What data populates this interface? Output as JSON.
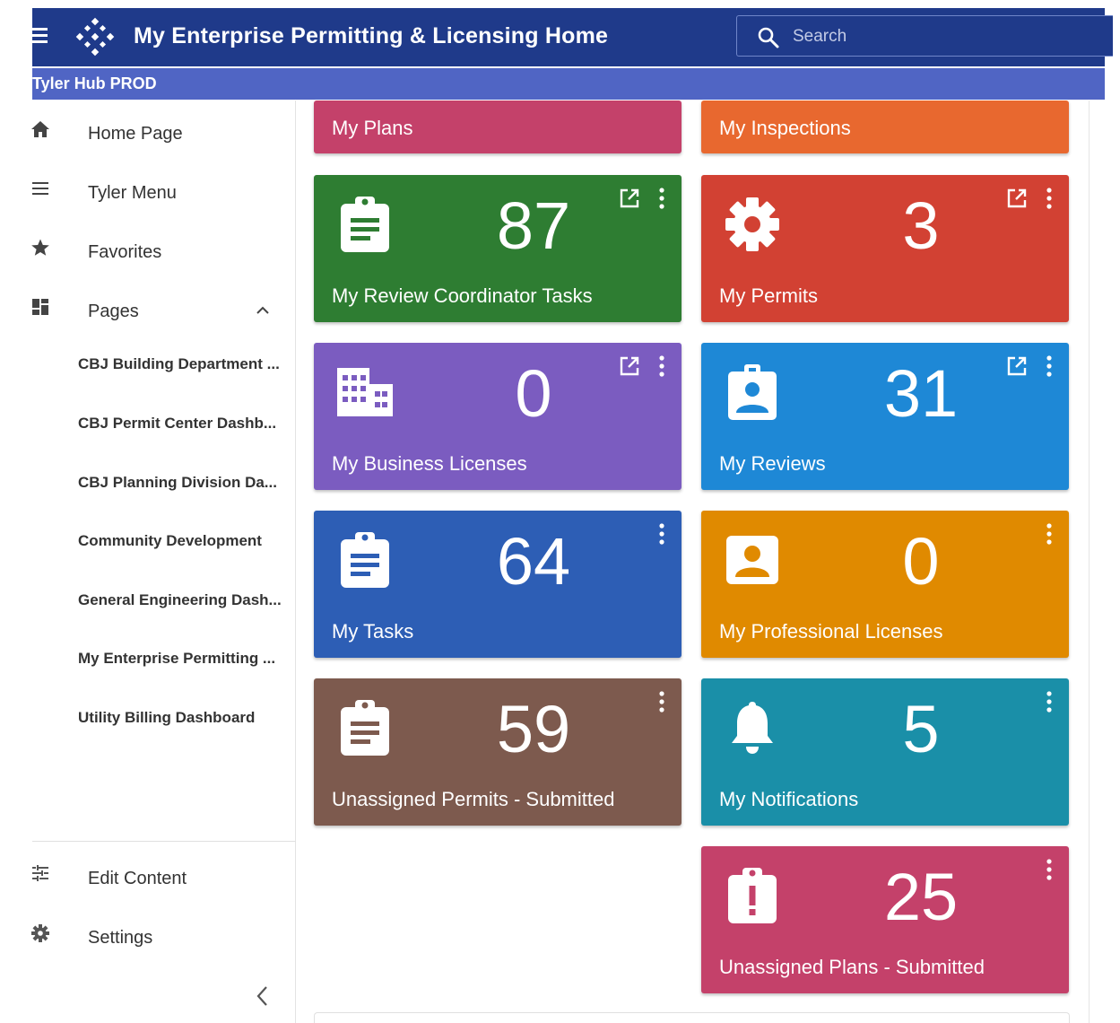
{
  "header": {
    "title": "My Enterprise Permitting & Licensing Home",
    "search_placeholder": "Search"
  },
  "environment": "Tyler Hub PROD",
  "sidebar": {
    "items": [
      {
        "label": "Home Page",
        "icon": "home-icon"
      },
      {
        "label": "Tyler Menu",
        "icon": "menu-icon"
      },
      {
        "label": "Favorites",
        "icon": "star-icon"
      },
      {
        "label": "Pages",
        "icon": "pages-icon"
      }
    ],
    "pages": [
      "CBJ Building Department ...",
      "CBJ Permit Center Dashb...",
      "CBJ Planning Division Da...",
      "Community Development",
      "General Engineering Dash...",
      "My Enterprise Permitting ...",
      "Utility Billing Dashboard"
    ],
    "bottom_items": [
      {
        "label": "Edit Content",
        "icon": "edit-content-icon"
      },
      {
        "label": "Settings",
        "icon": "settings-icon"
      }
    ]
  },
  "tiles": [
    {
      "label": "My Plans",
      "color": "#c4416a"
    },
    {
      "label": "My Inspections",
      "color": "#e8682f"
    },
    {
      "label": "My Review Coordinator Tasks",
      "count": "87",
      "color": "#2e7d32",
      "icon": "clipboard-icon"
    },
    {
      "label": "My Permits",
      "count": "3",
      "color": "#d24133",
      "icon": "gear-icon"
    },
    {
      "label": "My Business Licenses",
      "count": "0",
      "color": "#7b5cc0",
      "icon": "building-icon"
    },
    {
      "label": "My Reviews",
      "count": "31",
      "color": "#1e88d6",
      "icon": "badge-icon"
    },
    {
      "label": "My Tasks",
      "count": "64",
      "color": "#2d5eb5",
      "icon": "clipboard-icon"
    },
    {
      "label": "My Professional Licenses",
      "count": "0",
      "color": "#e08a00",
      "icon": "portrait-icon"
    },
    {
      "label": "Unassigned Permits - Submitted",
      "count": "59",
      "color": "#7d5a4e",
      "icon": "clipboard-icon"
    },
    {
      "label": "My Notifications",
      "count": "5",
      "color": "#1a8fa8",
      "icon": "bell-icon"
    },
    {
      "label": "Unassigned Plans - Submitted",
      "count": "25",
      "color": "#c4416a",
      "icon": "alert-clipboard-icon"
    }
  ]
}
